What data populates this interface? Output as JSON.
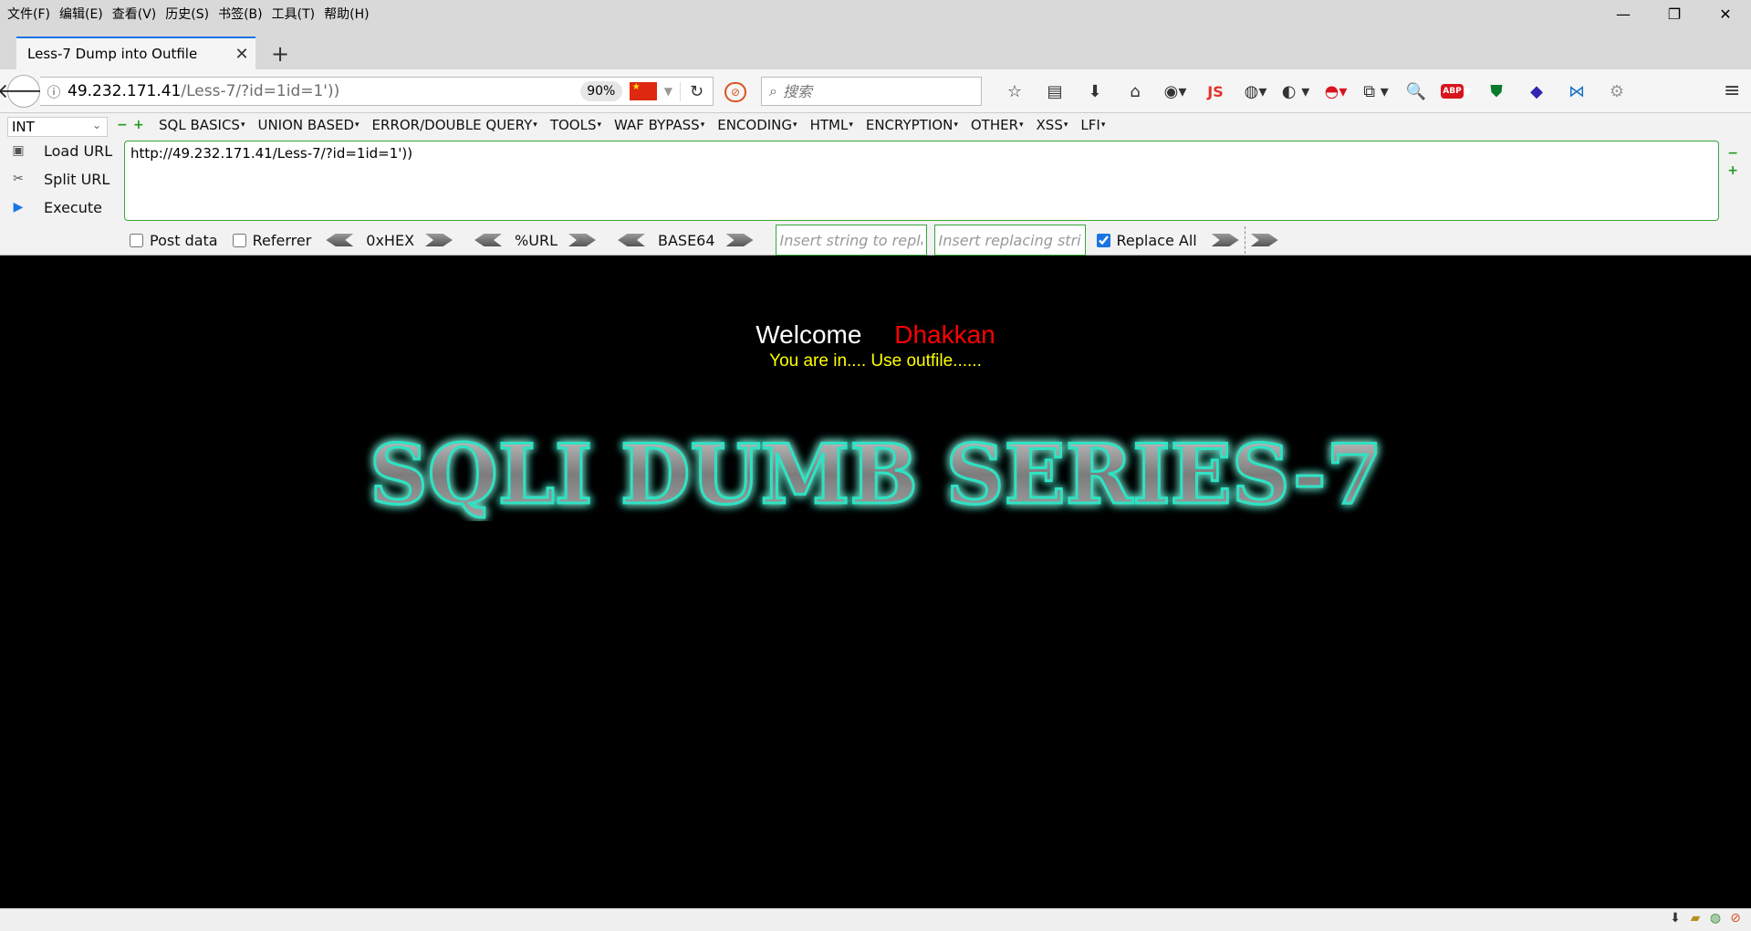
{
  "menubar": {
    "items": [
      "文件(F)",
      "编辑(E)",
      "查看(V)",
      "历史(S)",
      "书签(B)",
      "工具(T)",
      "帮助(H)"
    ]
  },
  "tab": {
    "title": "Less-7 Dump into Outfile"
  },
  "navbar": {
    "url_host": "49.232.171.41",
    "url_path": "/Less-7/?id=1id=1'))",
    "zoom": "90%",
    "search_placeholder": "搜索",
    "extension_js_label": "JS",
    "extension_abp_label": "ABP"
  },
  "hackbar": {
    "select_value": "INT",
    "menus": [
      "SQL BASICS",
      "UNION BASED",
      "ERROR/DOUBLE QUERY",
      "TOOLS",
      "WAF BYPASS",
      "ENCODING",
      "HTML",
      "ENCRYPTION",
      "OTHER",
      "XSS",
      "LFI"
    ],
    "load_url": "Load URL",
    "split_url": "Split URL",
    "execute": "Execute",
    "url_value": "http://49.232.171.41/Less-7/?id=1id=1'))",
    "post_data": "Post data",
    "referrer": "Referrer",
    "hex": "0xHEX",
    "url_enc": "%URL",
    "base64": "BASE64",
    "replace_from_placeholder": "Insert string to replace",
    "replace_to_placeholder": "Insert replacing string",
    "replace_all": "Replace All",
    "replace_all_checked": true
  },
  "page": {
    "welcome": "Welcome",
    "name": "Dhakkan",
    "status": "You are in.... Use outfile......",
    "banner": "SQLI DUMB SERIES-7"
  },
  "colors": {
    "welcome": "#ffffff",
    "name": "#ff0000",
    "status": "#ffff00",
    "banner_glow": "#2de3c4",
    "background": "#000000"
  }
}
